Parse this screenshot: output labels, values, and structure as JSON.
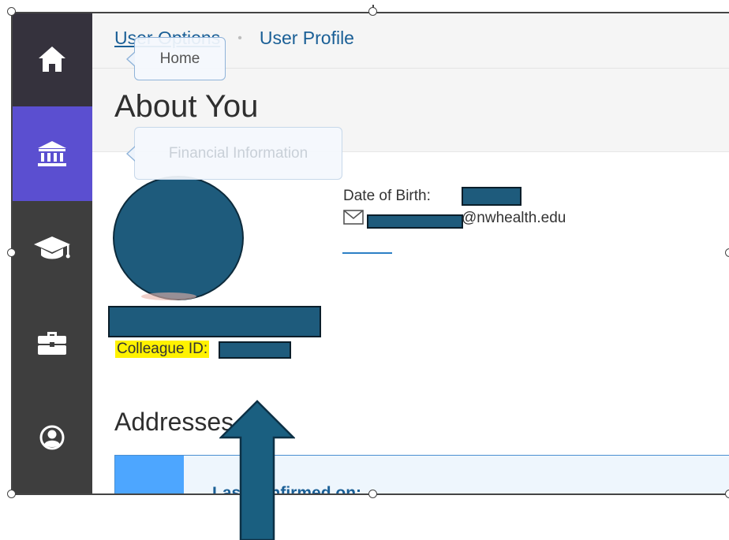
{
  "sidebar": {
    "items": [
      {
        "icon": "home-icon",
        "label": "Home"
      },
      {
        "icon": "bank-icon",
        "label": "Financial Information"
      },
      {
        "icon": "graduation-cap-icon"
      },
      {
        "icon": "briefcase-icon"
      },
      {
        "icon": "user-circle-icon"
      }
    ],
    "active_color": "#5b4fd0"
  },
  "breadcrumb": {
    "parent": "User Options",
    "separator": "•",
    "current": "User Profile"
  },
  "page": {
    "title": "About You"
  },
  "tooltips": {
    "home": "Home",
    "financial": "Financial Information"
  },
  "profile": {
    "dob_label": "Date of Birth:",
    "email_domain": "@nwhealth.edu",
    "colleague_label": "Colleague ID:"
  },
  "addresses": {
    "title": "Addresses",
    "card_text": "Last confirmed on:"
  },
  "colors": {
    "accent": "#1a5f96",
    "redaction": "#1e5b7c",
    "highlight": "#fff200"
  }
}
